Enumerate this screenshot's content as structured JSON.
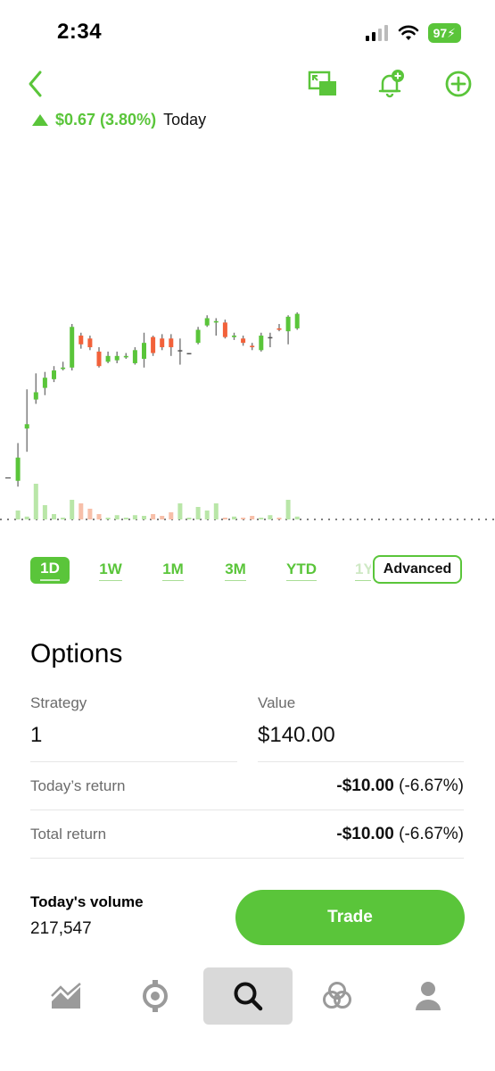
{
  "status_bar": {
    "time": "2:34",
    "battery": "97"
  },
  "nav": {
    "back_icon": "chevron-left-icon",
    "actions": [
      "pip-icon",
      "bell-add-icon",
      "plus-circle-icon"
    ]
  },
  "price_change": {
    "amount": "$0.67 (3.80%)",
    "period": "Today"
  },
  "chart_data": {
    "type": "candlestick",
    "candles": [
      {
        "o": 0.0,
        "c": 0.0,
        "h": 0.0,
        "l": 0.0
      },
      {
        "o": 1.0,
        "c": 2.6,
        "h": 3.6,
        "l": 0.6
      },
      {
        "o": 4.6,
        "c": 4.9,
        "h": 7.3,
        "l": 3.0
      },
      {
        "o": 6.6,
        "c": 7.1,
        "h": 8.4,
        "l": 6.3
      },
      {
        "o": 7.4,
        "c": 8.1,
        "h": 8.5,
        "l": 6.9
      },
      {
        "o": 8.0,
        "c": 8.6,
        "h": 8.9,
        "l": 7.8
      },
      {
        "o": 8.7,
        "c": 8.8,
        "h": 9.2,
        "l": 8.6
      },
      {
        "o": 8.8,
        "c": 11.6,
        "h": 11.8,
        "l": 8.6
      },
      {
        "o": 11.0,
        "c": 10.4,
        "h": 11.2,
        "l": 10.1
      },
      {
        "o": 10.8,
        "c": 10.2,
        "h": 11.0,
        "l": 10.0
      },
      {
        "o": 9.9,
        "c": 8.9,
        "h": 10.2,
        "l": 8.8
      },
      {
        "o": 9.2,
        "c": 9.6,
        "h": 9.9,
        "l": 9.1
      },
      {
        "o": 9.3,
        "c": 9.6,
        "h": 9.9,
        "l": 9.1
      },
      {
        "o": 9.5,
        "c": 9.6,
        "h": 9.8,
        "l": 9.4
      },
      {
        "o": 9.1,
        "c": 10.0,
        "h": 10.2,
        "l": 9.0
      },
      {
        "o": 9.4,
        "c": 10.5,
        "h": 11.2,
        "l": 8.8
      },
      {
        "o": 10.9,
        "c": 9.8,
        "h": 11.0,
        "l": 9.6
      },
      {
        "o": 10.8,
        "c": 10.2,
        "h": 11.1,
        "l": 10.0
      },
      {
        "o": 10.8,
        "c": 10.2,
        "h": 11.1,
        "l": 9.6
      },
      {
        "o": 10.0,
        "c": 10.0,
        "h": 10.8,
        "l": 9.0
      },
      {
        "o": 9.8,
        "c": 9.8,
        "h": 9.8,
        "l": 9.8
      },
      {
        "o": 10.5,
        "c": 11.4,
        "h": 11.6,
        "l": 10.4
      },
      {
        "o": 11.7,
        "c": 12.2,
        "h": 12.4,
        "l": 11.6
      },
      {
        "o": 11.9,
        "c": 12.0,
        "h": 12.2,
        "l": 11.0
      },
      {
        "o": 11.9,
        "c": 10.9,
        "h": 12.1,
        "l": 10.8
      },
      {
        "o": 10.9,
        "c": 11.0,
        "h": 11.2,
        "l": 10.7
      },
      {
        "o": 10.8,
        "c": 10.5,
        "h": 11.0,
        "l": 10.3
      },
      {
        "o": 10.3,
        "c": 10.2,
        "h": 10.5,
        "l": 10.0
      },
      {
        "o": 10.0,
        "c": 11.0,
        "h": 11.2,
        "l": 9.9
      },
      {
        "o": 10.9,
        "c": 10.9,
        "h": 11.2,
        "l": 10.2
      },
      {
        "o": 11.5,
        "c": 11.4,
        "h": 11.8,
        "l": 11.3
      },
      {
        "o": 11.3,
        "c": 12.3,
        "h": 12.4,
        "l": 10.4
      },
      {
        "o": 11.5,
        "c": 12.5,
        "h": 12.6,
        "l": 11.4
      }
    ],
    "volume_heights": [
      0.0,
      0.25,
      0.08,
      1.0,
      0.4,
      0.15,
      0.05,
      0.55,
      0.45,
      0.3,
      0.15,
      0.05,
      0.12,
      0.05,
      0.12,
      0.1,
      0.15,
      0.1,
      0.2,
      0.45,
      0.05,
      0.35,
      0.25,
      0.45,
      0.05,
      0.08,
      0.05,
      0.1,
      0.05,
      0.12,
      0.05,
      0.55,
      0.08
    ],
    "colors": {
      "up": "#5ac53a",
      "down": "#f2613a",
      "up_volume": "#b9e6a8",
      "down_volume": "#f7bfa9",
      "baseline": "#555555"
    }
  },
  "ranges": {
    "items": [
      "1D",
      "1W",
      "1M",
      "3M",
      "YTD",
      "1Y"
    ],
    "active": "1D",
    "advanced_label": "Advanced"
  },
  "options": {
    "title": "Options",
    "strategy_label": "Strategy",
    "strategy_value": "1",
    "value_label": "Value",
    "value_value": "$140.00",
    "todays_return_label": "Today’s return",
    "todays_return_amount": "-$10.00",
    "todays_return_pct": "(-6.67%)",
    "total_return_label": "Total return",
    "total_return_amount": "-$10.00",
    "total_return_pct": "(-6.67%)"
  },
  "footer": {
    "volume_label": "Today's volume",
    "volume_value": "217,547",
    "trade_label": "Trade"
  },
  "tabbar": {
    "items": [
      "investing-icon",
      "crypto-icon",
      "search-icon",
      "lists-icon",
      "account-icon"
    ],
    "active": "search-icon"
  },
  "accent_color": "#5ac53a"
}
